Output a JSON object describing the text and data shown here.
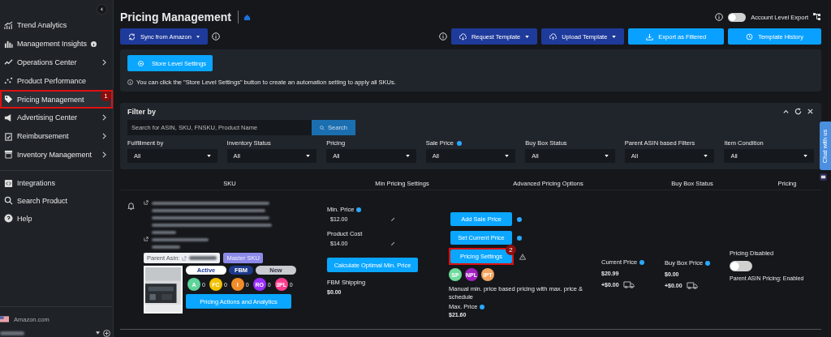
{
  "sidebar": {
    "items": [
      {
        "label": "Trend Analytics",
        "chevron": false,
        "info": false,
        "selected": false
      },
      {
        "label": "Management Insights",
        "chevron": false,
        "info": true,
        "selected": false
      },
      {
        "label": "Operations Center",
        "chevron": true,
        "info": false,
        "selected": false
      },
      {
        "label": "Product Performance",
        "chevron": false,
        "info": false,
        "selected": false
      },
      {
        "label": "Pricing Management",
        "chevron": false,
        "info": false,
        "selected": true,
        "step": "1"
      },
      {
        "label": "Advertising Center",
        "chevron": true,
        "info": false,
        "selected": false
      },
      {
        "label": "Reimbursement",
        "chevron": true,
        "info": false,
        "selected": false
      },
      {
        "label": "Inventory Management",
        "chevron": true,
        "info": false,
        "selected": false
      }
    ],
    "tools": [
      "Integrations",
      "Search Product",
      "Help"
    ],
    "marketplace": "Amazon.com"
  },
  "header": {
    "title": "Pricing Management",
    "export_toggle": {
      "label": "Account Level Export",
      "on": false
    }
  },
  "toolbar": {
    "left": [
      {
        "label": "Sync from Amazon",
        "kind": "dark",
        "caret": true
      }
    ],
    "right": [
      {
        "label": "Request Template",
        "kind": "dark",
        "caret": true
      },
      {
        "label": "Upload Template",
        "kind": "dark",
        "caret": true
      },
      {
        "label": "Export as Filtered",
        "kind": "light",
        "caret": false
      },
      {
        "label": "Template History",
        "kind": "light",
        "caret": false
      }
    ]
  },
  "store_panel": {
    "button": "Store Level Settings",
    "note": "You can click the \"Store Level Settings\" button to create an automation setting to apply all SKUs."
  },
  "filter": {
    "title": "Filter by",
    "search": {
      "placeholder": "Search for ASIN, SKU, FNSKU, Product Name",
      "button": "Search"
    },
    "filters": [
      {
        "label": "Fulfillment by",
        "value": "All",
        "info": false
      },
      {
        "label": "Inventory Status",
        "value": "All",
        "info": false
      },
      {
        "label": "Pricing",
        "value": "All",
        "info": false
      },
      {
        "label": "Sale Price",
        "value": "All",
        "info": true
      },
      {
        "label": "Buy Box Status",
        "value": "All",
        "info": false
      },
      {
        "label": "Parent ASIN based Filters",
        "value": "All",
        "info": false
      },
      {
        "label": "Item Condition",
        "value": "All",
        "info": false
      }
    ]
  },
  "table": {
    "columns": [
      "SKU",
      "Min Pricing Settings",
      "Advanced Pricing Options",
      "Buy Box Status",
      "Pricing"
    ],
    "row": {
      "parent_asin_label": "Parent Asin:",
      "master_sku": "Master SKU",
      "tags": [
        {
          "label": "Active",
          "kind": "light"
        },
        {
          "label": "FBM",
          "kind": "dark"
        },
        {
          "label": "New",
          "kind": "grey"
        }
      ],
      "counters": [
        {
          "label": "A",
          "count": "0",
          "color": "#5fd49a"
        },
        {
          "label": "FC",
          "count": "0",
          "color": "#f2c200"
        },
        {
          "label": "I",
          "count": "0",
          "color": "#f28c28"
        },
        {
          "label": "RO",
          "count": "0",
          "color": "#9b30ff"
        },
        {
          "label": "3PL",
          "count": "0",
          "color": "#ff3c8e"
        }
      ],
      "analytics_button": "Pricing Actions and Analytics",
      "min_settings": {
        "min_price_label": "Min. Price",
        "min_price": "$12.00",
        "cost_label": "Product Cost",
        "cost": "$14.00",
        "calc_button": "Calculate Optimal Min. Price",
        "shipping_label": "FBM Shipping",
        "shipping": "$0.00"
      },
      "advanced": {
        "buttons": [
          {
            "label": "Add Sale Price",
            "kind": "info"
          },
          {
            "label": "Set Current Price",
            "kind": "info"
          },
          {
            "label": "Pricing Settings",
            "kind": "warning",
            "step": "2"
          }
        ],
        "badges": [
          {
            "label": "SP",
            "color": "#6fdc9c"
          },
          {
            "label": "NPL",
            "color": "#a020c0"
          },
          {
            "label": "IPT",
            "color": "#f4a460"
          }
        ],
        "description": "Manual min. price based pricing with max. price & schedule",
        "max_label": "Max. Price",
        "max_price": "$21.60"
      },
      "current": {
        "label": "Current Price",
        "price": "$20.99",
        "shipping": "+$0.00"
      },
      "buy_box": {
        "label": "Buy Box Price",
        "price": "$0.00",
        "shipping": "+$0.00"
      },
      "pricing": {
        "label": "Pricing Disabled",
        "on": false,
        "parent_note": "Parent ASIN Pricing: Enabled"
      }
    }
  },
  "chat": {
    "label": "Chat with us"
  }
}
